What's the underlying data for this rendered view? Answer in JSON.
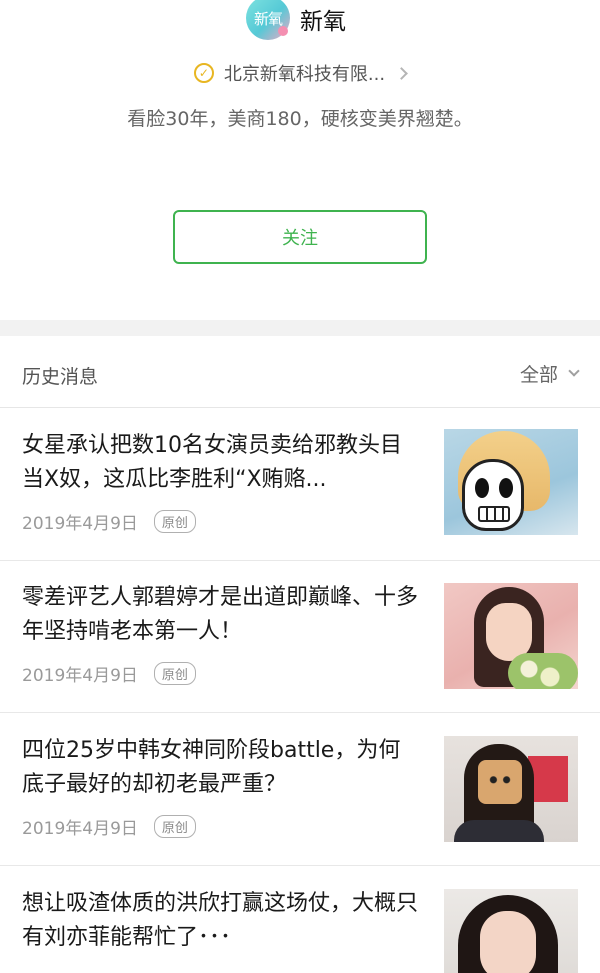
{
  "profile": {
    "avatar_text": "新氧",
    "name": "新氧",
    "verified_org": "北京新氧科技有限...",
    "bio": "看脸30年，美商180，硬核变美界翘楚。",
    "follow_label": "关注"
  },
  "history": {
    "title": "历史消息",
    "filter_label": "全部"
  },
  "articles": [
    {
      "title": "女星承认把数10名女演员卖给邪教头目当X奴，这瓜比李胜利“X贿赂...",
      "date": "2019年4月9日",
      "badge": "原创"
    },
    {
      "title": "零差评艺人郭碧婷才是出道即巅峰、十多年坚持啃老本第一人！",
      "date": "2019年4月9日",
      "badge": "原创"
    },
    {
      "title": "四位25岁中韩女神同阶段battle，为何底子最好的却初老最严重？",
      "date": "2019年4月9日",
      "badge": "原创"
    },
    {
      "title": "想让吸渣体质的洪欣打赢这场仗，大概只有刘亦菲能帮忙了･･･",
      "date": "",
      "badge": ""
    }
  ],
  "colors": {
    "accent_green": "#3fb34f",
    "verify_gold": "#e8b622"
  }
}
